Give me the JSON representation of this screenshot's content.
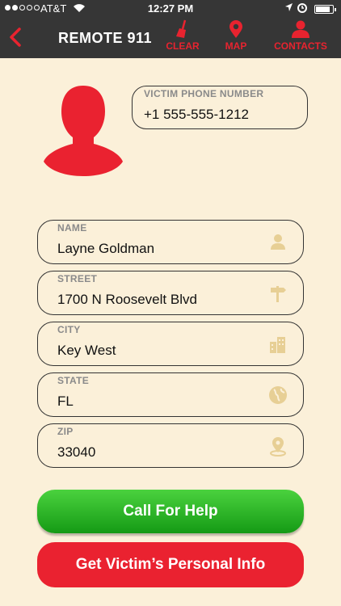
{
  "status_bar": {
    "carrier": "AT&T",
    "time": "12:27 PM"
  },
  "nav": {
    "title": "REMOTE 911",
    "clear_label": "CLEAR",
    "map_label": "MAP",
    "contacts_label": "CONTACTS"
  },
  "victim": {
    "phone_label": "VICTIM PHONE NUMBER",
    "phone_value": "+1 555-555-1212"
  },
  "form": {
    "name": {
      "label": "NAME",
      "value": "Layne Goldman",
      "icon": "person-icon"
    },
    "street": {
      "label": "STREET",
      "value": "1700 N Roosevelt Blvd",
      "icon": "signpost-icon"
    },
    "city": {
      "label": "CITY",
      "value": "Key West",
      "icon": "buildings-icon"
    },
    "state": {
      "label": "STATE",
      "value": "FL",
      "icon": "globe-icon"
    },
    "zip": {
      "label": "ZIP",
      "value": "33040",
      "icon": "location-pin-icon"
    }
  },
  "buttons": {
    "call_label": "Call For Help",
    "info_label": "Get Victim’s Personal Info"
  },
  "colors": {
    "accent_red": "#e8232f",
    "header_bg": "#363636",
    "page_bg": "#fbf0d9",
    "call_green": "#2fb52a",
    "icon_tan": "#e7cf95"
  }
}
